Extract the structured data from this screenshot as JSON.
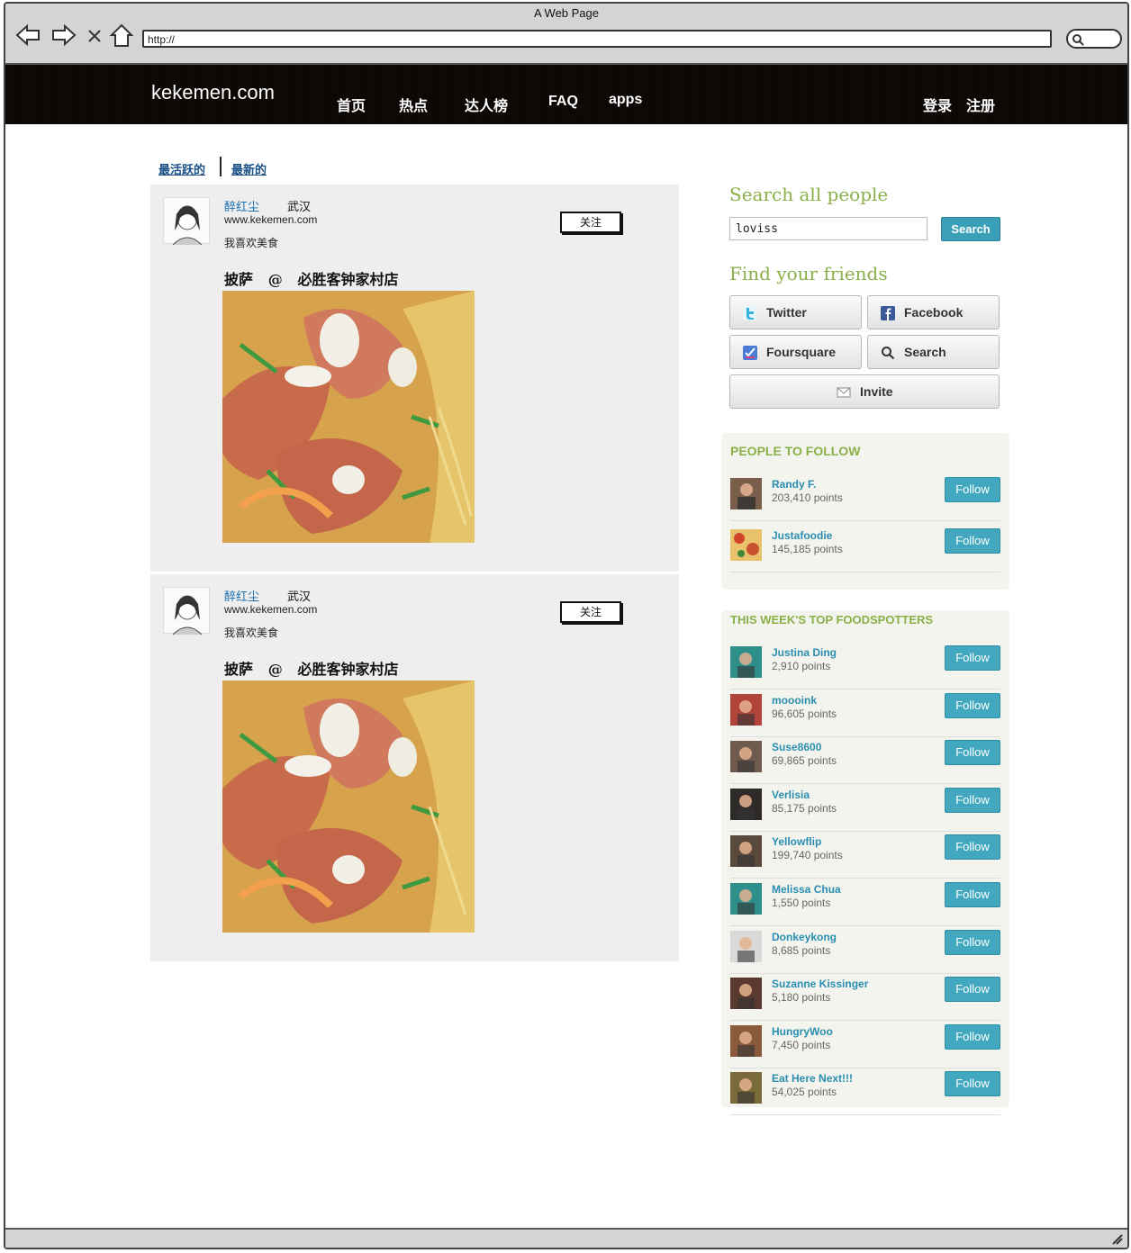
{
  "browser": {
    "title": "A Web Page",
    "url": "http://"
  },
  "site": {
    "logo": "kekemen.com",
    "nav": [
      "首页",
      "热点",
      "达人榜",
      "FAQ",
      "apps"
    ],
    "login": "登录",
    "register": "注册"
  },
  "tabs": {
    "active": "最活跃的",
    "newest": "最新的"
  },
  "feed": [
    {
      "user": "醉红尘",
      "city": "武汉",
      "site": "www.kekemen.com",
      "bio": "我喜欢美食",
      "follow": "关注",
      "dish": "披萨",
      "at": "@",
      "place": "必胜客钟家村店"
    },
    {
      "user": "醉红尘",
      "city": "武汉",
      "site": "www.kekemen.com",
      "bio": "我喜欢美食",
      "follow": "关注",
      "dish": "披萨",
      "at": "@",
      "place": "必胜客钟家村店"
    }
  ],
  "sidebar": {
    "search_heading": "Search all people",
    "search_value": "loviss",
    "search_button": "Search",
    "friends_heading": "Find your friends",
    "friends_buttons": {
      "twitter": "Twitter",
      "facebook": "Facebook",
      "foursquare": "Foursquare",
      "search": "Search",
      "invite": "Invite"
    },
    "people_title": "PEOPLE TO FOLLOW",
    "people": [
      {
        "name": "Randy F.",
        "points": "203,410 points",
        "button": "Follow"
      },
      {
        "name": "Justafoodie",
        "points": "145,185 points",
        "button": "Follow"
      }
    ],
    "top_title": "THIS WEEK'S TOP FOODSPOTTERS",
    "top": [
      {
        "name": "Justina Ding",
        "points": "2,910 points",
        "button": "Follow"
      },
      {
        "name": "moooink",
        "points": "96,605 points",
        "button": "Follow"
      },
      {
        "name": "Suse8600",
        "points": "69,865 points",
        "button": "Follow"
      },
      {
        "name": "Verlisia",
        "points": "85,175 points",
        "button": "Follow"
      },
      {
        "name": "Yellowflip",
        "points": "199,740 points",
        "button": "Follow"
      },
      {
        "name": "Melissa Chua",
        "points": "1,550 points",
        "button": "Follow"
      },
      {
        "name": "Donkeykong",
        "points": "8,685 points",
        "button": "Follow"
      },
      {
        "name": "Suzanne Kissinger",
        "points": "5,180 points",
        "button": "Follow"
      },
      {
        "name": "HungryWoo",
        "points": "7,450 points",
        "button": "Follow"
      },
      {
        "name": "Eat Here Next!!!",
        "points": "54,025 points",
        "button": "Follow"
      }
    ]
  },
  "colors": {
    "accent_green": "#8ab047",
    "follow_blue": "#41a8bf",
    "link_blue": "#2a8eb0",
    "header_brown": "#3a3029"
  }
}
